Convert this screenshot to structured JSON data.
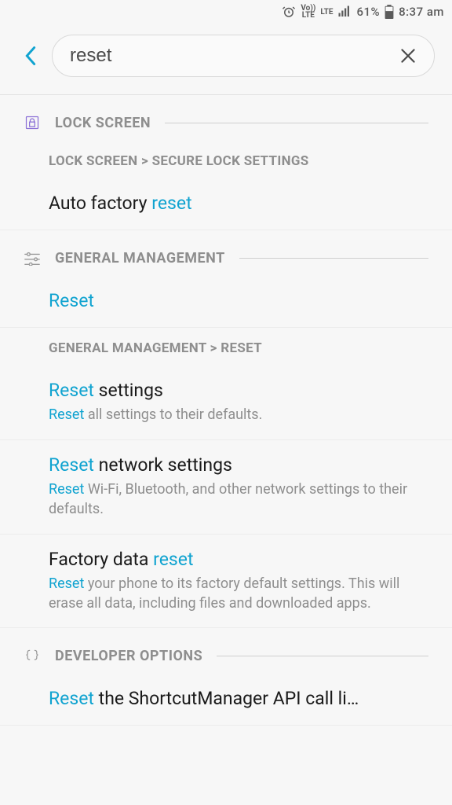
{
  "status": {
    "battery_pct": "61%",
    "time": "8:37 am",
    "net_small1": "Vo))\nLTE",
    "net_small2": "LTE"
  },
  "search": {
    "value": "reset"
  },
  "sections": {
    "lock": {
      "label": "LOCK SCREEN",
      "breadcrumb": "LOCK SCREEN > SECURE LOCK SETTINGS",
      "item1_pre": "Auto factory ",
      "item1_hl": "reset"
    },
    "gm": {
      "label": "GENERAL MANAGEMENT",
      "item1": "Reset",
      "breadcrumb": "GENERAL MANAGEMENT > RESET",
      "item2_hl": "Reset",
      "item2_rest": " settings",
      "item2_sub_hl": "Reset",
      "item2_sub_rest": " all settings to their defaults.",
      "item3_hl": "Reset",
      "item3_rest": " network settings",
      "item3_sub_hl": "Reset",
      "item3_sub_rest": " Wi-Fi, Bluetooth, and other network settings to their defaults.",
      "item4_pre": "Factory data ",
      "item4_hl": "reset",
      "item4_sub_hl": "Reset",
      "item4_sub_rest": " your phone to its factory default settings. This will erase all data, including files and downloaded apps."
    },
    "dev": {
      "label": "DEVELOPER OPTIONS",
      "item1_hl": "Reset",
      "item1_rest": " the ShortcutManager API call li…"
    }
  }
}
